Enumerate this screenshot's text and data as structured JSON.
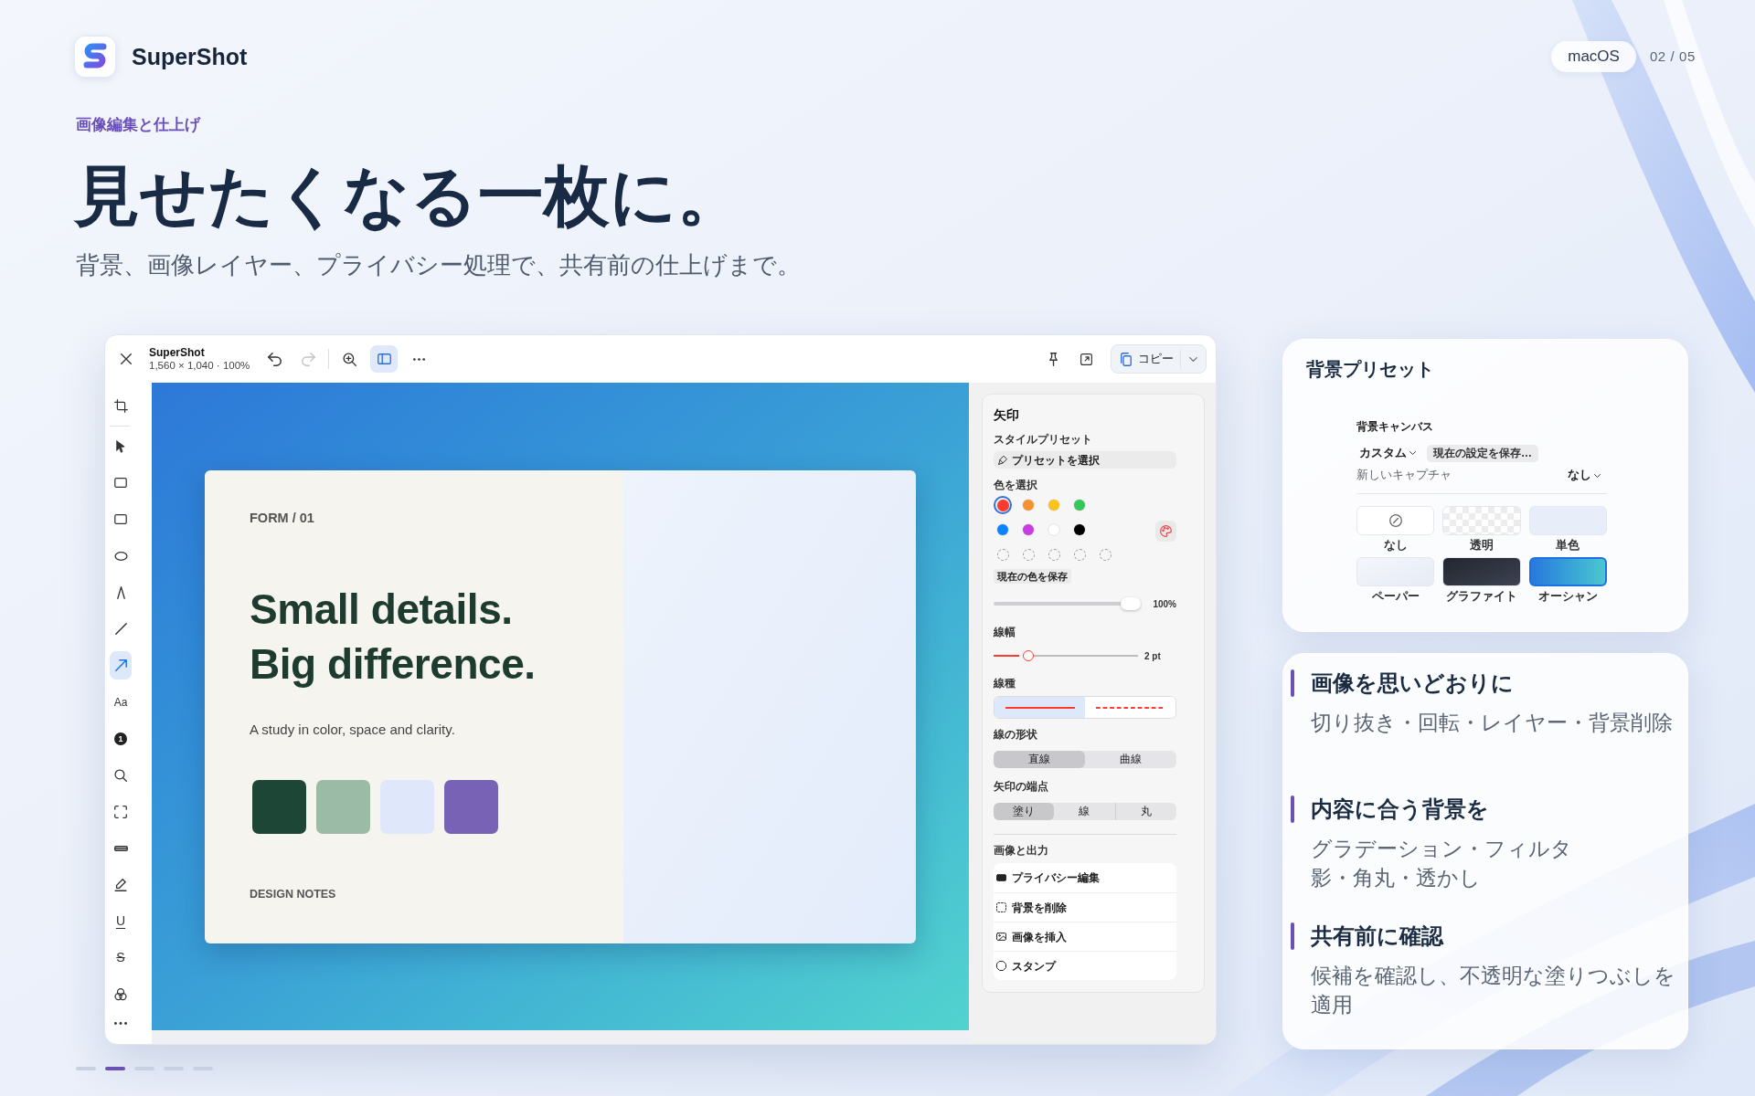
{
  "brand": {
    "name": "SuperShot"
  },
  "badges": {
    "platform": "macOS",
    "page": "02 / 05"
  },
  "hero": {
    "eyebrow": "画像編集と仕上げ",
    "title": "見せたくなる一枚に。",
    "subtitle": "背景、画像レイヤー、プライバシー処理で、共有前の仕上げまで。"
  },
  "editor": {
    "toolbar": {
      "title": "SuperShot",
      "info": "1,560 × 1,040 · 100%",
      "undo": {
        "disabled": false
      },
      "redo": {
        "disabled": true
      },
      "sidebar_toggle": {
        "on": true
      },
      "copy_button": {
        "label": "コピー"
      }
    },
    "tools": [
      {
        "kind": "crop",
        "selected": false
      },
      {
        "kind": "pointer",
        "selected": false
      },
      {
        "kind": "rectangle",
        "selected": false
      },
      {
        "kind": "rectangle",
        "selected": false
      },
      {
        "kind": "ellipse",
        "selected": false
      },
      {
        "kind": "pen",
        "selected": false
      },
      {
        "kind": "line",
        "selected": false
      },
      {
        "kind": "arrow",
        "selected": true
      },
      {
        "kind": "text",
        "label": "Aa",
        "selected": false
      },
      {
        "kind": "counter",
        "label": "1",
        "selected": false
      },
      {
        "kind": "magnifier",
        "selected": false
      },
      {
        "kind": "selection",
        "selected": false
      },
      {
        "kind": "highlighter",
        "selected": false
      },
      {
        "kind": "pencil",
        "selected": false
      },
      {
        "kind": "underline",
        "label": "U",
        "selected": false
      },
      {
        "kind": "strikethrough",
        "label": "S",
        "selected": false
      },
      {
        "kind": "blend",
        "selected": false
      },
      {
        "kind": "more",
        "selected": false
      }
    ],
    "canvas": {
      "document": {
        "label": "FORM / 01",
        "headline": [
          "Small details.",
          "Big difference."
        ],
        "tagline": "A study in color, space and clarity.",
        "swatches": [
          {
            "color": "#1e4636"
          },
          {
            "color": "#9bbba7"
          },
          {
            "color": "#dfe8fb"
          },
          {
            "color": "#7762b6"
          }
        ],
        "footer": "DESIGN NOTES"
      }
    },
    "inspector": {
      "title": "矢印",
      "style_preset": {
        "label": "スタイルプリセット",
        "button": "プリセットを選択"
      },
      "colors": {
        "label": "色を選択",
        "swatches": [
          {
            "color": "#ff3b30",
            "selected": true
          },
          {
            "color": "#f7902f",
            "selected": false
          },
          {
            "color": "#fcc419",
            "selected": false
          },
          {
            "color": "#34c759",
            "selected": false
          },
          {
            "color": "#0a84ff",
            "selected": false
          },
          {
            "color": "#c83de0",
            "selected": false
          },
          {
            "color": "#ffffff",
            "selected": false
          },
          {
            "color": "#000000",
            "selected": false
          }
        ],
        "custom_slots": [
          {
            "filled": false
          },
          {
            "filled": false
          },
          {
            "filled": false
          },
          {
            "filled": false
          },
          {
            "filled": false
          }
        ],
        "save_button": "現在の色を保存"
      },
      "opacity": {
        "level": 1,
        "reading": "100%"
      },
      "stroke_width": {
        "label": "線幅",
        "level": 0.22,
        "reading": "2 pt"
      },
      "line_style": {
        "label": "線種",
        "options": [
          {
            "kind": "solid",
            "selected": true
          },
          {
            "kind": "dashed",
            "selected": false
          }
        ]
      },
      "line_shape": {
        "label": "線の形状",
        "options": [
          {
            "label": "直線",
            "selected": true
          },
          {
            "label": "曲線",
            "selected": false
          }
        ]
      },
      "arrow_ends": {
        "label": "矢印の端点",
        "options": [
          {
            "label": "塗り",
            "selected": true
          },
          {
            "label": "線",
            "selected": false
          },
          {
            "label": "丸",
            "selected": false
          }
        ]
      },
      "image_output": {
        "label": "画像と出力",
        "items": [
          {
            "kind": "privacy",
            "label": "プライバシー編集"
          },
          {
            "kind": "remove_background",
            "label": "背景を削除"
          },
          {
            "kind": "insert_image",
            "label": "画像を挿入"
          },
          {
            "kind": "stamp",
            "label": "スタンプ"
          }
        ]
      }
    }
  },
  "background_presets": {
    "title": "背景プリセット",
    "panel": {
      "heading": "背景キャンバス",
      "preset_menu": "カスタム",
      "save_button": "現在の設定を保存…",
      "new_capture": {
        "label": "新しいキャプチャ",
        "value": "なし"
      },
      "tiles": [
        {
          "kind": "none",
          "label": "なし",
          "selected": false
        },
        {
          "kind": "transparent",
          "label": "透明",
          "selected": false
        },
        {
          "kind": "solid",
          "label": "単色",
          "selected": false
        },
        {
          "kind": "paper",
          "label": "ペーパー",
          "selected": false
        },
        {
          "kind": "graphite",
          "label": "グラファイト",
          "selected": false
        },
        {
          "kind": "ocean",
          "label": "オーシャン",
          "selected": true
        }
      ]
    }
  },
  "features": [
    {
      "title": "画像を思いどおりに",
      "lines": [
        "切り抜き・回転・レイヤー・背景削除"
      ]
    },
    {
      "title": "内容に合う背景を",
      "lines": [
        "グラデーション・フィルタ",
        "影・角丸・透かし"
      ]
    },
    {
      "title": "共有前に確認",
      "lines": [
        "候補を確認し、不透明な塗りつぶしを適用"
      ]
    }
  ],
  "pagination": [
    {
      "selected": false
    },
    {
      "selected": true
    },
    {
      "selected": false
    },
    {
      "selected": false
    },
    {
      "selected": false
    }
  ]
}
